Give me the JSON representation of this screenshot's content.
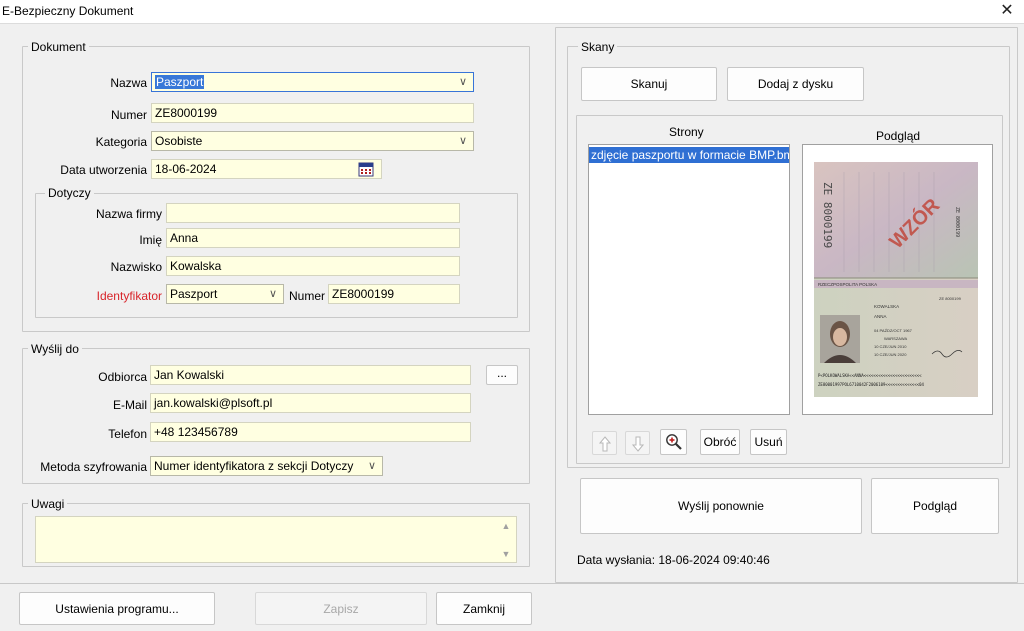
{
  "window": {
    "title": "E-Bezpieczny Dokument",
    "close_glyph": "✕"
  },
  "dokument": {
    "legend": "Dokument",
    "nazwa_label": "Nazwa",
    "nazwa_value": "Paszport",
    "numer_label": "Numer",
    "numer_value": "ZE8000199",
    "kategoria_label": "Kategoria",
    "kategoria_value": "Osobiste",
    "data_label": "Data utworzenia",
    "data_value": "18-06-2024",
    "dotyczy": {
      "legend": "Dotyczy",
      "firma_label": "Nazwa firmy",
      "firma_value": "",
      "imie_label": "Imię",
      "imie_value": "Anna",
      "nazwisko_label": "Nazwisko",
      "nazwisko_value": "Kowalska",
      "identyfikator_label": "Identyfikator",
      "identyfikator_value": "Paszport",
      "numer_label": "Numer",
      "numer_value": "ZE8000199"
    }
  },
  "wyslij": {
    "legend": "Wyślij do",
    "odbiorca_label": "Odbiorca",
    "odbiorca_value": "Jan Kowalski",
    "more_label": "...",
    "email_label": "E-Mail",
    "email_value": "jan.kowalski@plsoft.pl",
    "telefon_label": "Telefon",
    "telefon_value": "+48 123456789",
    "metoda_label": "Metoda szyfrowania",
    "metoda_value": "Numer identyfikatora z sekcji Dotyczy"
  },
  "uwagi": {
    "legend": "Uwagi",
    "value": ""
  },
  "skany": {
    "legend": "Skany",
    "skanuj_label": "Skanuj",
    "dodaj_label": "Dodaj z dysku",
    "strony_label": "Strony",
    "podglad_label": "Podgląd",
    "pages": [
      "zdjęcie paszportu w formacie BMP.bmp"
    ],
    "obroc_label": "Obróć",
    "usun_label": "Usuń",
    "preview": {
      "serial_vertical": "ZE 8000199",
      "stamp": "WZÓR",
      "country": "RZECZPOSPOLITA POLSKA",
      "passport_no": "ZE 8000199",
      "surname": "KOWALSKA",
      "given": "ANNA",
      "dob": "04 PAŹDZ/OCT 1967",
      "pob": "WARSZAWA",
      "issue": "10 CZE/JUN 2010",
      "expiry": "10 CZE/JUN 2020",
      "mrz1": "P<POLKOWALSKA<<ANNA<<<<<<<<<<<<<<<<<<<<<<<<",
      "mrz2": "ZE80001997POL6710042F2006109<<<<<<<<<<<<<<04"
    }
  },
  "actions": {
    "wyslij_ponownie_label": "Wyślij ponownie",
    "podglad_label": "Podgląd",
    "data_wyslania": "Data wysłania: 18-06-2024 09:40:46"
  },
  "footer": {
    "ustawienia_label": "Ustawienia programu...",
    "zapisz_label": "Zapisz",
    "zamknij_label": "Zamknij"
  }
}
